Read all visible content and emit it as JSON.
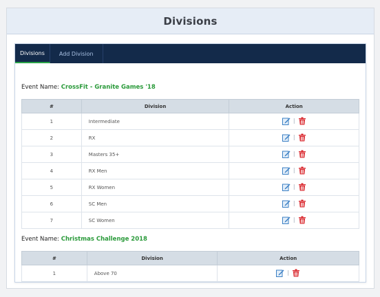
{
  "page": {
    "title": "Divisions"
  },
  "tabs": [
    {
      "label": "Divisions",
      "active": true
    },
    {
      "label": "Add Division",
      "active": false
    }
  ],
  "event_label": "Event Name:",
  "table_headers": {
    "num": "#",
    "division": "Division",
    "action": "Action"
  },
  "events": [
    {
      "name": "CrossFit - Granite Games '18",
      "rows": [
        {
          "num": "1",
          "division": "Intermediate"
        },
        {
          "num": "2",
          "division": "RX"
        },
        {
          "num": "3",
          "division": "Masters 35+"
        },
        {
          "num": "4",
          "division": "RX Men"
        },
        {
          "num": "5",
          "division": "RX Women"
        },
        {
          "num": "6",
          "division": "SC Men"
        },
        {
          "num": "7",
          "division": "SC Women"
        }
      ]
    },
    {
      "name": "Christmas Challenge 2018",
      "rows": [
        {
          "num": "1",
          "division": "Above 70"
        }
      ]
    }
  ],
  "icons": {
    "edit": "edit-icon",
    "delete": "trash-icon",
    "separator": "|"
  },
  "colors": {
    "accent": "#2a9a3a",
    "tab_bar": "#132a4a",
    "delete": "#d9262c",
    "edit": "#3a7fc4"
  }
}
